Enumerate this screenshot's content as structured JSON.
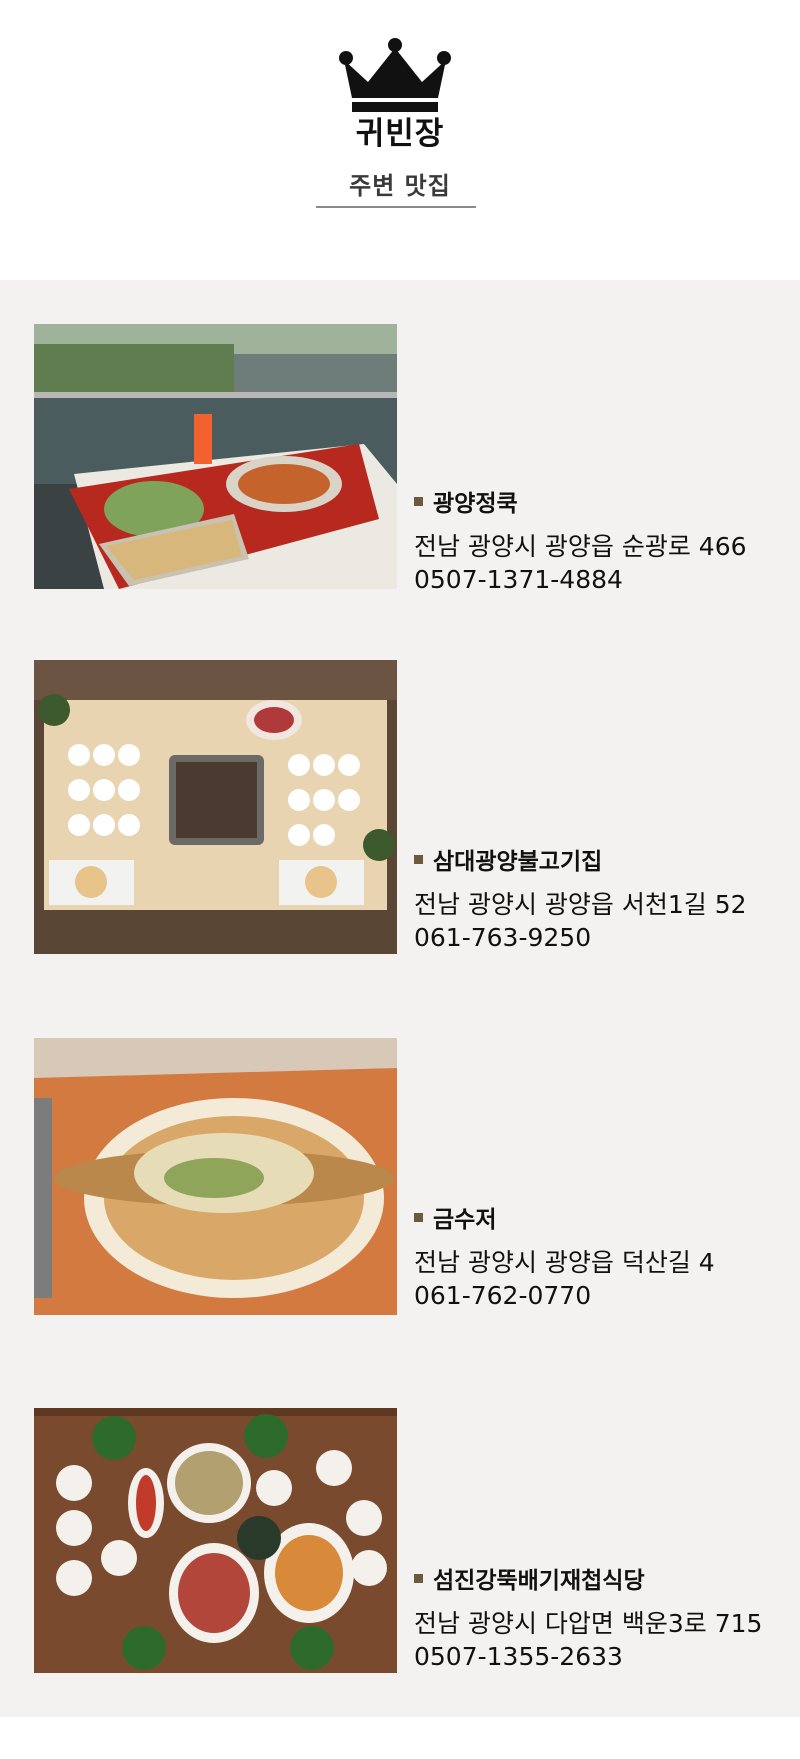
{
  "header": {
    "brand": "귀빈장",
    "subtitle": "주변 맛집",
    "logo_icon": "crown-icon"
  },
  "colors": {
    "content_bg": "#f4f2f1",
    "bullet": "#6b5a3e",
    "underline": "#8a8a8a"
  },
  "restaurants": [
    {
      "name": "광양정쿡",
      "address": "전남 광양시 광양읍 순광로 466",
      "phone": "0507-1371-4884",
      "photo": "terrace-table-with-food-photo"
    },
    {
      "name": "삼대광양불고기집",
      "address": "전남 광양시 광양읍 서천1길 52",
      "phone": "061-763-9250",
      "photo": "bulgogi-grill-table-photo"
    },
    {
      "name": "금수저",
      "address": "전남 광양시 광양읍 덕산길 4",
      "phone": "061-762-0770",
      "photo": "fried-fish-dish-photo"
    },
    {
      "name": "섬진강뚝배기재첩식당",
      "address": "전남 광양시 다압면 백운3로 715",
      "phone": "0507-1355-2633",
      "photo": "korean-side-dishes-table-photo"
    }
  ]
}
